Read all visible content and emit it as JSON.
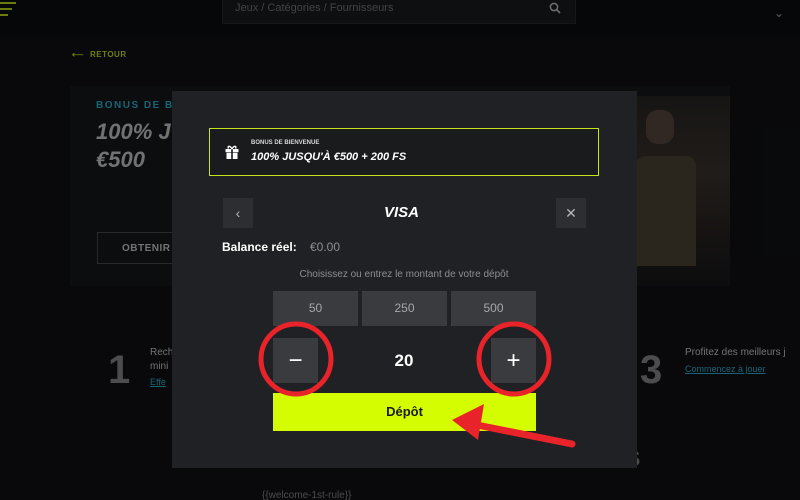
{
  "header": {
    "search_placeholder": "Jeux / Catégories / Fournisseurs",
    "chevron_glyph": "⌄"
  },
  "back": {
    "arrow": "⟵",
    "label": "RETOUR"
  },
  "hero": {
    "kicker": "BONUS DE B",
    "line1": "100% J",
    "line2": "€500",
    "button_label": "OBTENIR"
  },
  "steps": [
    {
      "number": "1",
      "text_line1": "Rech",
      "text_line2": "mini",
      "link": "Effe"
    },
    {
      "number": "3",
      "text": "Profitez des meilleurs j",
      "link": "Commencez à jouer"
    }
  ],
  "footer": {
    "big_letter": "s",
    "rule_text": "{{welcome-1st-rule}}"
  },
  "modal": {
    "bonus": {
      "small_label": "BONUS DE BIENVENUE",
      "offer": "100% JUSQU'À €500 + 200 FS"
    },
    "payment_method": "VISA",
    "prev_glyph": "‹",
    "close_glyph": "✕",
    "balance_label": "Balance réel:",
    "balance_value": "€0.00",
    "amount_hint": "Choisissez ou entrez le montant de votre dépôt",
    "presets": [
      "50",
      "250",
      "500"
    ],
    "minus_glyph": "−",
    "plus_glyph": "+",
    "amount_value": "20",
    "deposit_label": "Dépôt"
  },
  "colors": {
    "accent": "#d5fd01",
    "link": "#2fb6d6",
    "annotation": "#e8242a",
    "modal_bg": "#202124"
  }
}
